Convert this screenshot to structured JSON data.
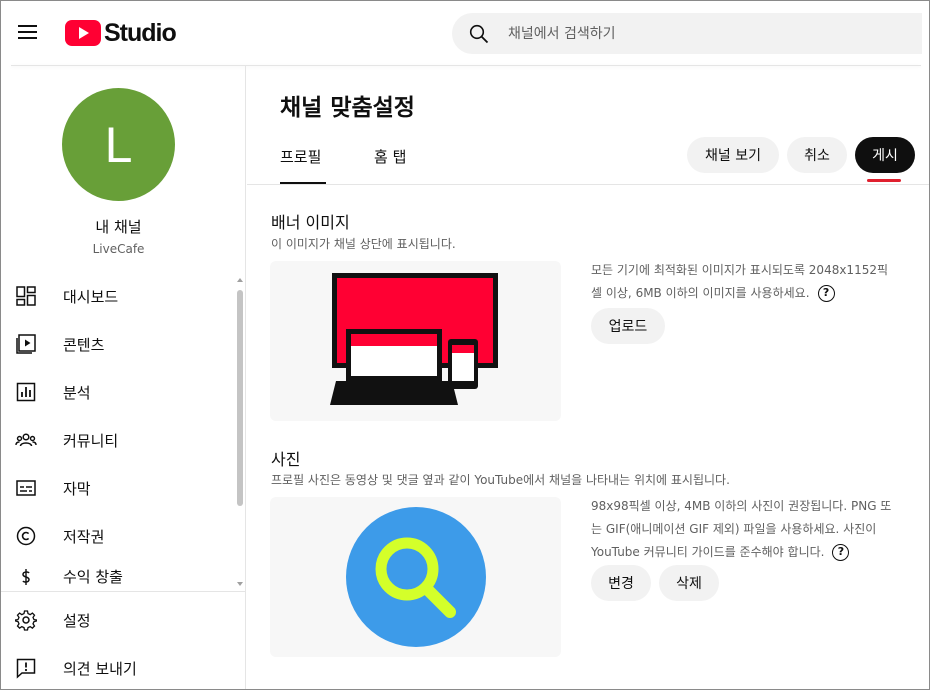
{
  "app": {
    "name": "Studio"
  },
  "search": {
    "placeholder": "채널에서 검색하기"
  },
  "sidebar": {
    "avatar_letter": "L",
    "my_channel_label": "내 채널",
    "channel_name": "LiveCafe",
    "items": [
      {
        "label": "대시보드",
        "icon": "dashboard-icon"
      },
      {
        "label": "콘텐츠",
        "icon": "content-icon"
      },
      {
        "label": "분석",
        "icon": "analytics-icon"
      },
      {
        "label": "커뮤니티",
        "icon": "community-icon"
      },
      {
        "label": "자막",
        "icon": "subtitles-icon"
      },
      {
        "label": "저작권",
        "icon": "copyright-icon"
      },
      {
        "label": "수익 창출",
        "icon": "monetization-icon"
      }
    ],
    "bottom_items": [
      {
        "label": "설정",
        "icon": "settings-icon"
      },
      {
        "label": "의견 보내기",
        "icon": "feedback-icon"
      }
    ]
  },
  "main": {
    "title": "채널 맞춤설정",
    "tabs": [
      {
        "label": "프로필",
        "active": true
      },
      {
        "label": "홈 탭",
        "active": false
      }
    ],
    "buttons": {
      "view_channel": "채널 보기",
      "cancel": "취소",
      "publish": "게시"
    },
    "banner": {
      "title": "배너 이미지",
      "desc": "이 이미지가 채널 상단에 표시됩니다.",
      "info_line1": "모든 기기에 최적화된 이미지가 표시되도록 2048x1152픽",
      "info_line2": "셀 이상, 6MB 이하의 이미지를 사용하세요.",
      "upload_label": "업로드"
    },
    "photo": {
      "title": "사진",
      "desc": "프로필 사진은 동영상 및 댓글 옆과 같이 YouTube에서 채널을 나타내는 위치에 표시됩니다.",
      "info_line1": "98x98픽셀 이상, 4MB 이하의 사진이 권장됩니다. PNG 또",
      "info_line2": "는 GIF(애니메이션 GIF 제외) 파일을 사용하세요. 사진이",
      "info_line3": "YouTube 커뮤니티 가이드를 준수해야 합니다.",
      "change_label": "변경",
      "delete_label": "삭제"
    },
    "help_glyph": "?"
  },
  "colors": {
    "brand_red": "#ff0033",
    "avatar_green": "#689f38",
    "profile_blue": "#3d9be9",
    "magnifier_yellow": "#d4ff2a",
    "publish_underline": "#e0202e"
  }
}
